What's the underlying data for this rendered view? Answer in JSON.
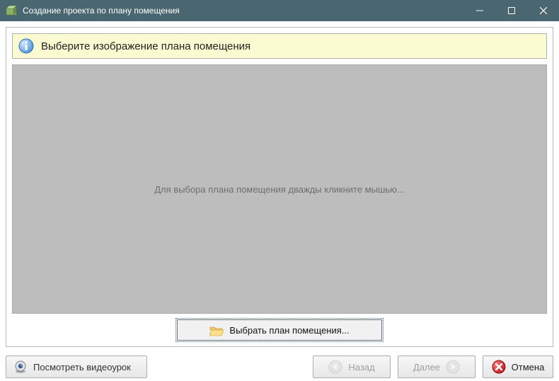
{
  "window": {
    "title": "Создание проекта по плану помещения"
  },
  "banner": {
    "text": "Выберите изображение плана помещения"
  },
  "preview": {
    "placeholder": "Для выбора плана помещения дважды кликните мышью..."
  },
  "buttons": {
    "select_plan": "Выбрать план помещения...",
    "video": "Посмотреть видеоурок",
    "back": "Назад",
    "next": "Далее",
    "cancel": "Отмена"
  }
}
